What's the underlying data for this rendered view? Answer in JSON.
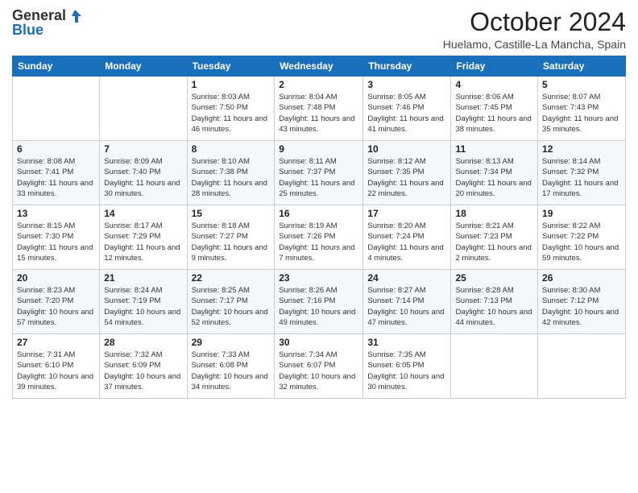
{
  "logo": {
    "general": "General",
    "blue": "Blue"
  },
  "title": {
    "month": "October 2024",
    "location": "Huelamo, Castille-La Mancha, Spain"
  },
  "weekdays": [
    "Sunday",
    "Monday",
    "Tuesday",
    "Wednesday",
    "Thursday",
    "Friday",
    "Saturday"
  ],
  "weeks": [
    [
      null,
      null,
      {
        "day": 1,
        "sunrise": "8:03 AM",
        "sunset": "7:50 PM",
        "daylight": "11 hours and 46 minutes."
      },
      {
        "day": 2,
        "sunrise": "8:04 AM",
        "sunset": "7:48 PM",
        "daylight": "11 hours and 43 minutes."
      },
      {
        "day": 3,
        "sunrise": "8:05 AM",
        "sunset": "7:46 PM",
        "daylight": "11 hours and 41 minutes."
      },
      {
        "day": 4,
        "sunrise": "8:06 AM",
        "sunset": "7:45 PM",
        "daylight": "11 hours and 38 minutes."
      },
      {
        "day": 5,
        "sunrise": "8:07 AM",
        "sunset": "7:43 PM",
        "daylight": "11 hours and 35 minutes."
      }
    ],
    [
      {
        "day": 6,
        "sunrise": "8:08 AM",
        "sunset": "7:41 PM",
        "daylight": "11 hours and 33 minutes."
      },
      {
        "day": 7,
        "sunrise": "8:09 AM",
        "sunset": "7:40 PM",
        "daylight": "11 hours and 30 minutes."
      },
      {
        "day": 8,
        "sunrise": "8:10 AM",
        "sunset": "7:38 PM",
        "daylight": "11 hours and 28 minutes."
      },
      {
        "day": 9,
        "sunrise": "8:11 AM",
        "sunset": "7:37 PM",
        "daylight": "11 hours and 25 minutes."
      },
      {
        "day": 10,
        "sunrise": "8:12 AM",
        "sunset": "7:35 PM",
        "daylight": "11 hours and 22 minutes."
      },
      {
        "day": 11,
        "sunrise": "8:13 AM",
        "sunset": "7:34 PM",
        "daylight": "11 hours and 20 minutes."
      },
      {
        "day": 12,
        "sunrise": "8:14 AM",
        "sunset": "7:32 PM",
        "daylight": "11 hours and 17 minutes."
      }
    ],
    [
      {
        "day": 13,
        "sunrise": "8:15 AM",
        "sunset": "7:30 PM",
        "daylight": "11 hours and 15 minutes."
      },
      {
        "day": 14,
        "sunrise": "8:17 AM",
        "sunset": "7:29 PM",
        "daylight": "11 hours and 12 minutes."
      },
      {
        "day": 15,
        "sunrise": "8:18 AM",
        "sunset": "7:27 PM",
        "daylight": "11 hours and 9 minutes."
      },
      {
        "day": 16,
        "sunrise": "8:19 AM",
        "sunset": "7:26 PM",
        "daylight": "11 hours and 7 minutes."
      },
      {
        "day": 17,
        "sunrise": "8:20 AM",
        "sunset": "7:24 PM",
        "daylight": "11 hours and 4 minutes."
      },
      {
        "day": 18,
        "sunrise": "8:21 AM",
        "sunset": "7:23 PM",
        "daylight": "11 hours and 2 minutes."
      },
      {
        "day": 19,
        "sunrise": "8:22 AM",
        "sunset": "7:22 PM",
        "daylight": "10 hours and 59 minutes."
      }
    ],
    [
      {
        "day": 20,
        "sunrise": "8:23 AM",
        "sunset": "7:20 PM",
        "daylight": "10 hours and 57 minutes."
      },
      {
        "day": 21,
        "sunrise": "8:24 AM",
        "sunset": "7:19 PM",
        "daylight": "10 hours and 54 minutes."
      },
      {
        "day": 22,
        "sunrise": "8:25 AM",
        "sunset": "7:17 PM",
        "daylight": "10 hours and 52 minutes."
      },
      {
        "day": 23,
        "sunrise": "8:26 AM",
        "sunset": "7:16 PM",
        "daylight": "10 hours and 49 minutes."
      },
      {
        "day": 24,
        "sunrise": "8:27 AM",
        "sunset": "7:14 PM",
        "daylight": "10 hours and 47 minutes."
      },
      {
        "day": 25,
        "sunrise": "8:28 AM",
        "sunset": "7:13 PM",
        "daylight": "10 hours and 44 minutes."
      },
      {
        "day": 26,
        "sunrise": "8:30 AM",
        "sunset": "7:12 PM",
        "daylight": "10 hours and 42 minutes."
      }
    ],
    [
      {
        "day": 27,
        "sunrise": "7:31 AM",
        "sunset": "6:10 PM",
        "daylight": "10 hours and 39 minutes."
      },
      {
        "day": 28,
        "sunrise": "7:32 AM",
        "sunset": "6:09 PM",
        "daylight": "10 hours and 37 minutes."
      },
      {
        "day": 29,
        "sunrise": "7:33 AM",
        "sunset": "6:08 PM",
        "daylight": "10 hours and 34 minutes."
      },
      {
        "day": 30,
        "sunrise": "7:34 AM",
        "sunset": "6:07 PM",
        "daylight": "10 hours and 32 minutes."
      },
      {
        "day": 31,
        "sunrise": "7:35 AM",
        "sunset": "6:05 PM",
        "daylight": "10 hours and 30 minutes."
      },
      null,
      null
    ]
  ]
}
